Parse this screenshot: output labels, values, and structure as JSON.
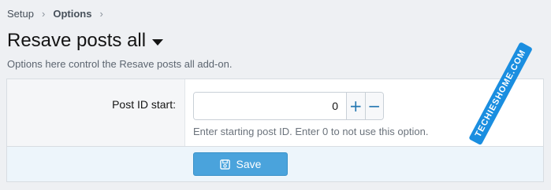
{
  "breadcrumb": {
    "items": [
      "Setup",
      "Options"
    ],
    "separator": "›"
  },
  "page": {
    "title": "Resave posts all",
    "description": "Options here control the Resave posts all add-on."
  },
  "form": {
    "field_label": "Post ID start:",
    "value": "0",
    "increment_label": "+",
    "decrement_label": "−",
    "hint": "Enter starting post ID. Enter 0 to not use this option.",
    "save_label": "Save"
  },
  "watermark": {
    "text": "TECHIESHOME.COM"
  },
  "icons": {
    "caret": "caret-down-icon",
    "save": "save-icon"
  },
  "colors": {
    "accent": "#4aa3dc",
    "link": "#2577b1"
  }
}
